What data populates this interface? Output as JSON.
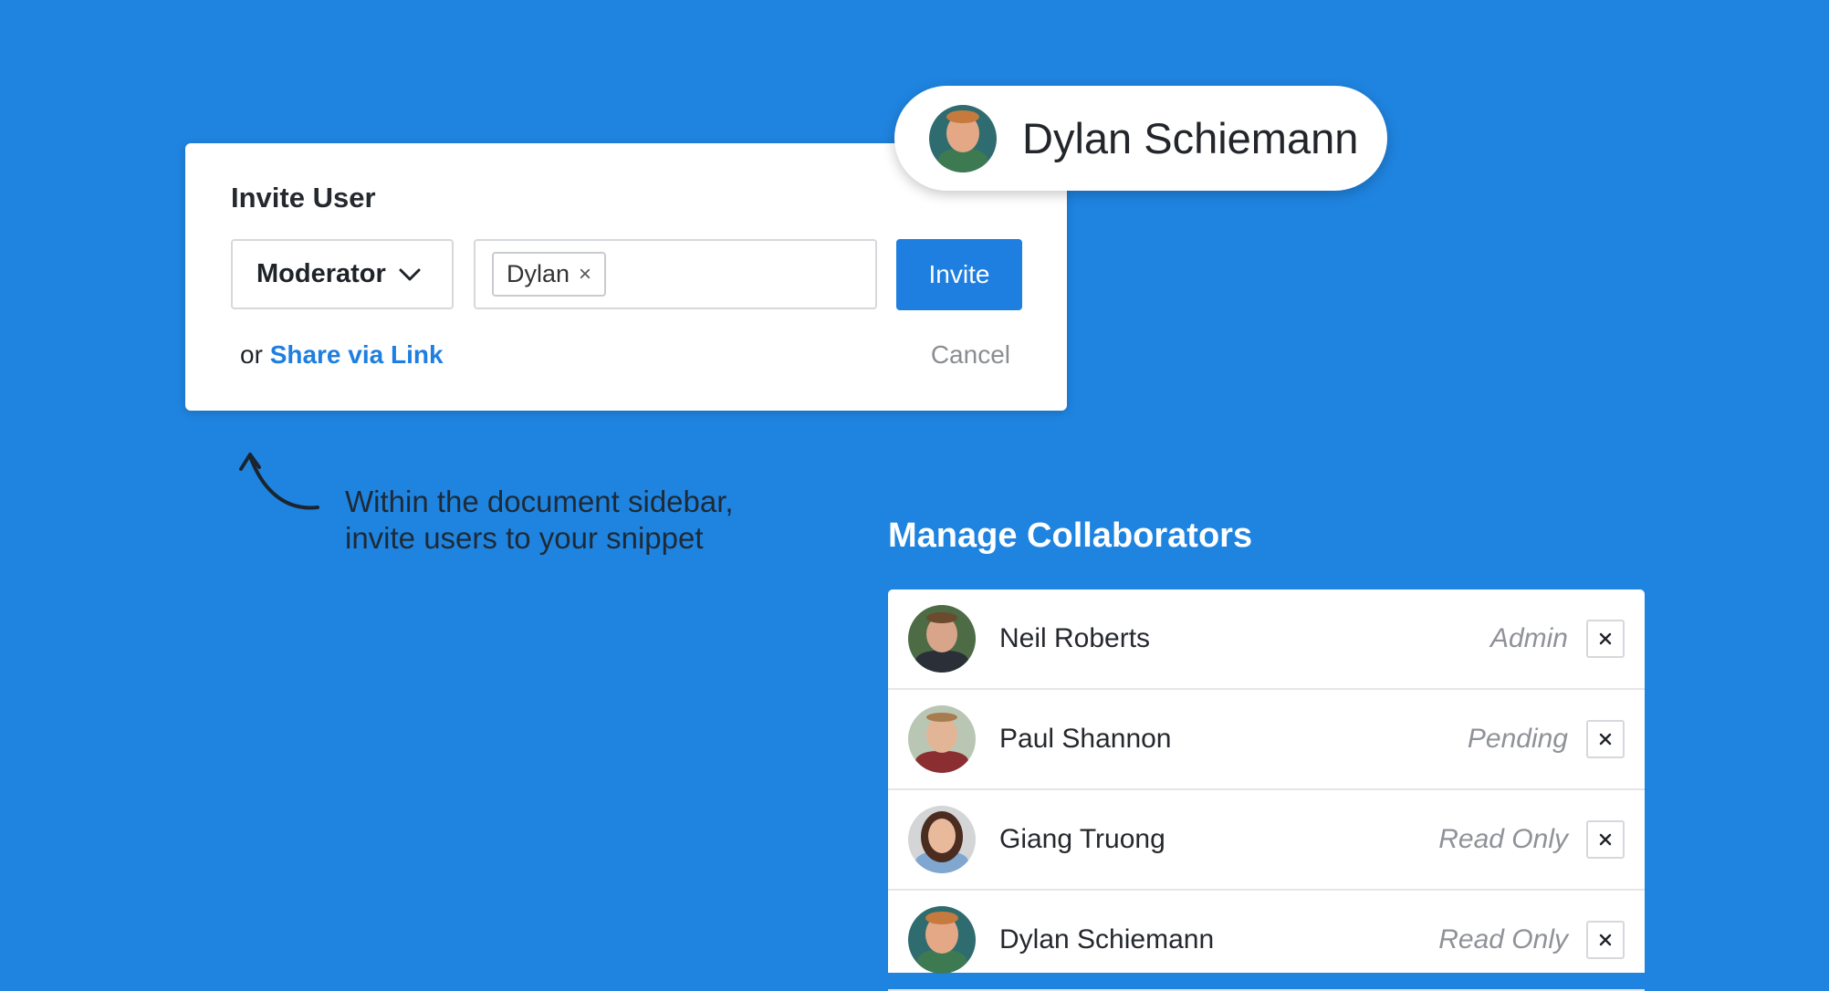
{
  "invite": {
    "title": "Invite User",
    "role": "Moderator",
    "chip": "Dylan",
    "chip_remove": "×",
    "invite_label": "Invite",
    "or_text": "or ",
    "share_link": "Share via Link",
    "cancel_label": "Cancel"
  },
  "pill": {
    "name": "Dylan Schiemann"
  },
  "hint": {
    "line1": "Within the document sidebar,",
    "line2": "invite users to your snippet"
  },
  "manage": {
    "title": "Manage Collaborators",
    "remove_glyph": "×",
    "rows": [
      {
        "name": "Neil Roberts",
        "role": "Admin"
      },
      {
        "name": "Paul Shannon",
        "role": "Pending"
      },
      {
        "name": "Giang Truong",
        "role": "Read Only"
      },
      {
        "name": "Dylan Schiemann",
        "role": "Read Only"
      }
    ]
  },
  "colors": {
    "background": "#1f84e0",
    "accent": "#1e7fe0",
    "muted": "#8f9297"
  }
}
